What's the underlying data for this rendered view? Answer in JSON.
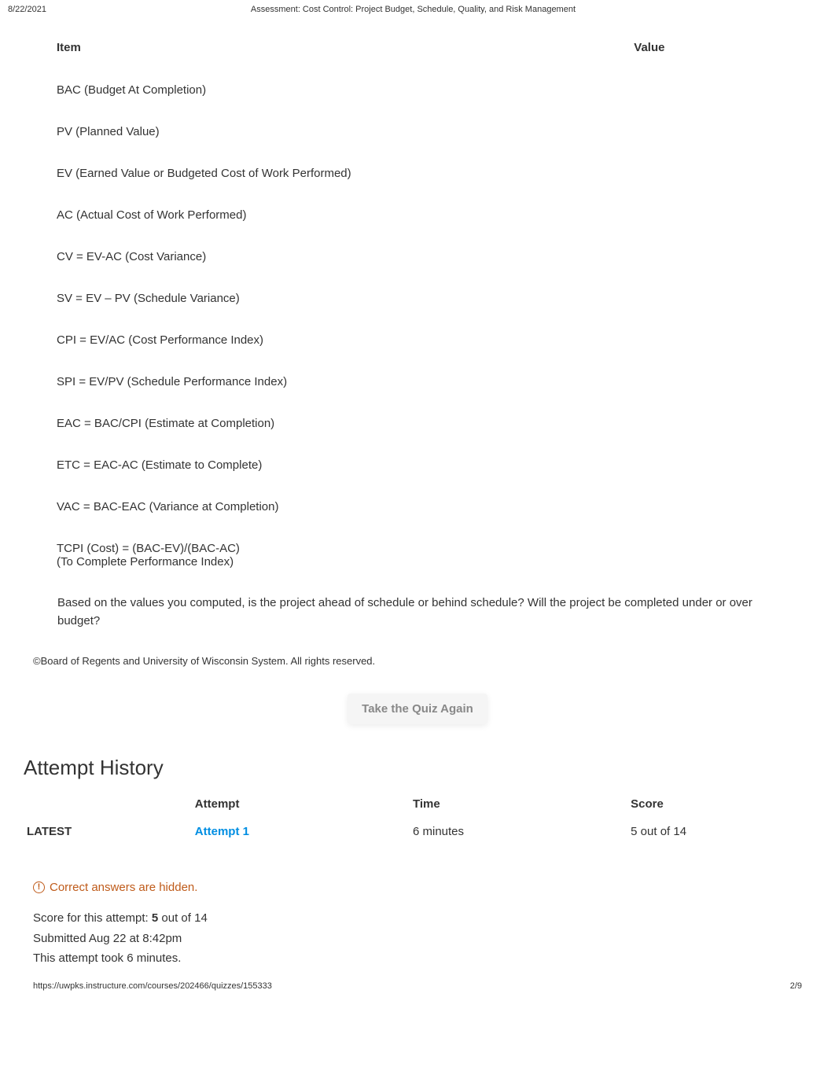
{
  "header": {
    "date": "8/22/2021",
    "title": "Assessment: Cost Control: Project Budget, Schedule, Quality, and Risk Management"
  },
  "item_table": {
    "header_item": "Item",
    "header_value": "Value",
    "rows": [
      {
        "item": "BAC (Budget At Completion)",
        "value": ""
      },
      {
        "item": "PV (Planned Value)",
        "value": ""
      },
      {
        "item": "EV (Earned Value or Budgeted Cost of Work Performed)",
        "value": ""
      },
      {
        "item": "AC (Actual Cost of Work Performed)",
        "value": ""
      },
      {
        "item": "CV = EV-AC (Cost Variance)",
        "value": ""
      },
      {
        "item": "SV = EV – PV (Schedule Variance)",
        "value": ""
      },
      {
        "item": "CPI = EV/AC (Cost Performance Index)",
        "value": ""
      },
      {
        "item": "SPI = EV/PV (Schedule Performance Index)",
        "value": ""
      },
      {
        "item": "EAC = BAC/CPI (Estimate at Completion)",
        "value": ""
      },
      {
        "item": "ETC = EAC-AC (Estimate to Complete)",
        "value": ""
      },
      {
        "item": "VAC = BAC-EAC (Variance at Completion)",
        "value": ""
      },
      {
        "item": "TCPI (Cost) = (BAC-EV)/(BAC-AC)\n(To Complete Performance Index)",
        "value": ""
      }
    ]
  },
  "question": "Based on the values you computed, is the project ahead of schedule or behind schedule? Will the project be completed under or over budget?",
  "copyright": "©Board of Regents and University of Wisconsin System. All rights reserved.",
  "take_quiz_label": "Take the Quiz Again",
  "attempt_history": {
    "heading": "Attempt History",
    "columns": {
      "status": "",
      "attempt": "Attempt",
      "time": "Time",
      "score": "Score"
    },
    "rows": [
      {
        "status": "LATEST",
        "attempt": "Attempt 1",
        "time": "6 minutes",
        "score": "5 out of 14"
      }
    ]
  },
  "correct_hidden": "Correct answers are hidden.",
  "score_info": {
    "line1_prefix": "Score for this attempt: ",
    "line1_bold": "5",
    "line1_suffix": " out of 14",
    "line2": "Submitted Aug 22 at 8:42pm",
    "line3": "This attempt took 6 minutes."
  },
  "footer": {
    "url": "https://uwpks.instructure.com/courses/202466/quizzes/155333",
    "page": "2/9"
  }
}
